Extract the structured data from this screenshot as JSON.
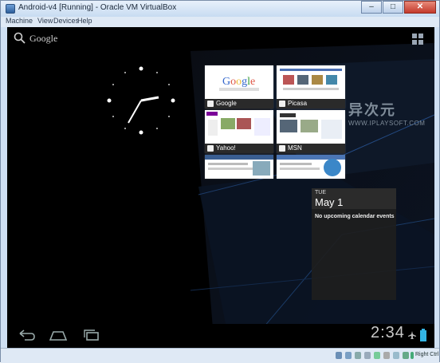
{
  "window": {
    "title": "Android-v4 [Running] - Oracle VM VirtualBox",
    "controls": {
      "minimize": "–",
      "maximize": "□",
      "close": "✕"
    },
    "menu": [
      "Machine",
      "View",
      "Devices",
      "Help"
    ]
  },
  "android": {
    "search_label": "Google",
    "thumbnails": [
      {
        "label": "Google"
      },
      {
        "label": "Picasa"
      },
      {
        "label": "Yahoo!"
      },
      {
        "label": "MSN"
      },
      {
        "label": ""
      },
      {
        "label": ""
      }
    ],
    "calendar": {
      "day_of_week": "TUE",
      "date": "May 1",
      "empty_text": "No upcoming calendar events"
    },
    "status_time": "2:34",
    "nav": {
      "back": "back-icon",
      "home": "home-icon",
      "recents": "recents-icon"
    }
  },
  "watermark": {
    "chinese": "异次元",
    "english": "WWW.IPLAYSOFT.COM"
  },
  "statusbar": {
    "host_key": "Right Ctrl"
  },
  "colors": {
    "title_bg": "#c7dbf1",
    "screen_bg": "#000000",
    "accent": "#33b5e5"
  }
}
